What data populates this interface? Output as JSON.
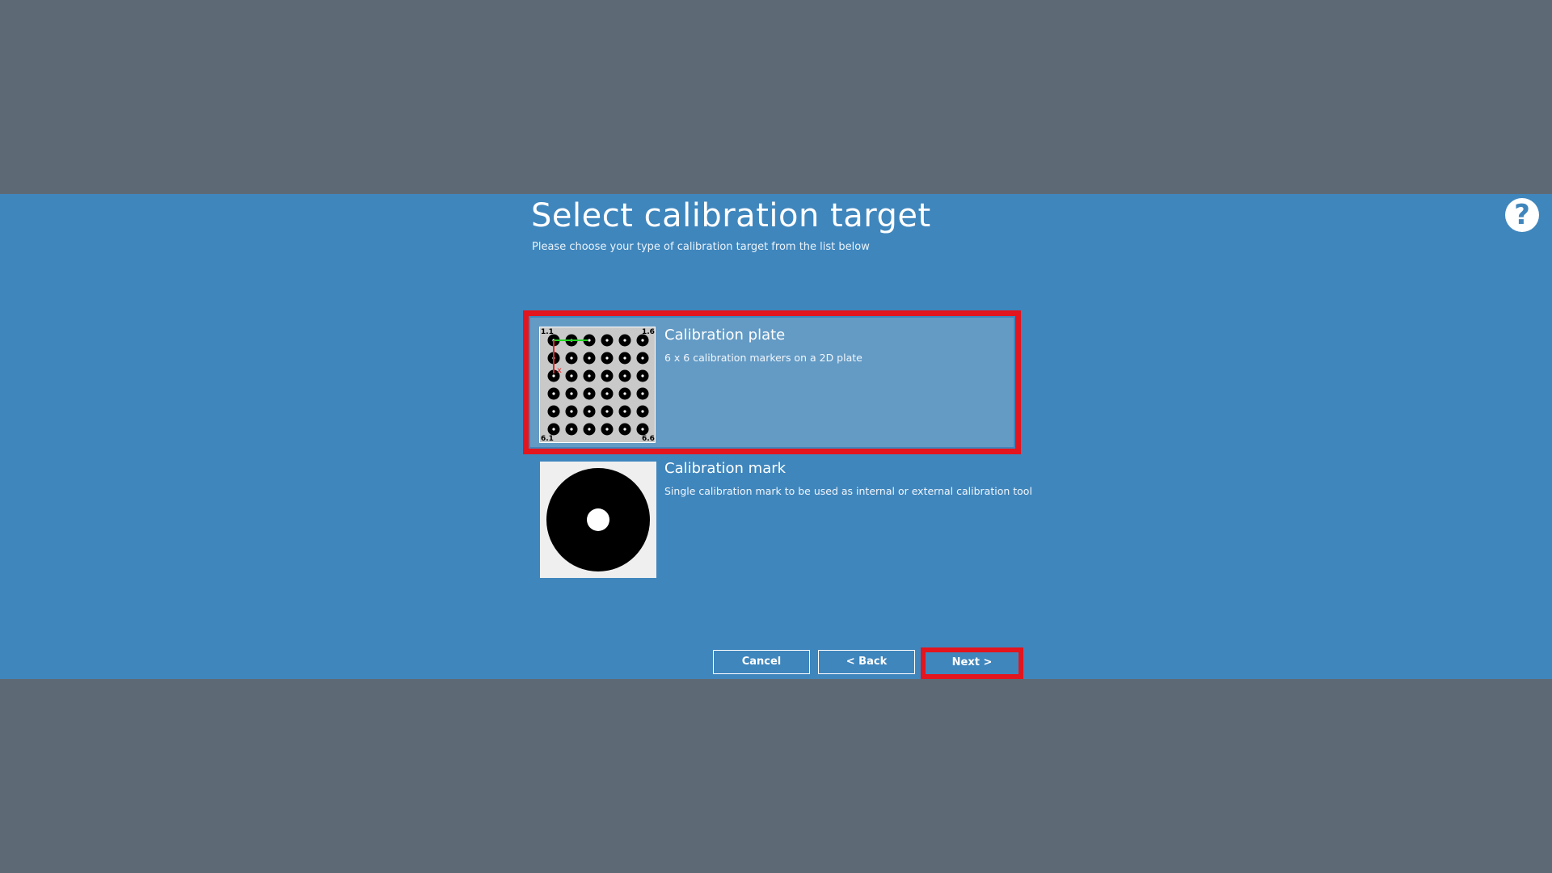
{
  "header": {
    "title": "Select calibration target",
    "subtitle": "Please choose your type of calibration target from the list below",
    "help_icon": "question-circle-icon"
  },
  "options": [
    {
      "title": "Calibration plate",
      "description": "6 x 6 calibration markers on a 2D plate",
      "selected": true,
      "thumbnail": {
        "icon": "calibration-plate-grid-icon",
        "corner_labels": [
          "1.1",
          "1.6",
          "6.1",
          "6.6"
        ],
        "axis_label": "x"
      }
    },
    {
      "title": "Calibration mark",
      "description": "Single calibration mark to be used as internal or external calibration tool",
      "selected": false,
      "thumbnail": {
        "icon": "calibration-mark-icon"
      }
    }
  ],
  "buttons": {
    "cancel": "Cancel",
    "back": "< Back",
    "next": "Next >"
  },
  "colors": {
    "page_background": "#5d6a75",
    "panel_background": "#3f86bd",
    "selected_item": "#649bc5",
    "highlight_border": "#e3151e"
  }
}
